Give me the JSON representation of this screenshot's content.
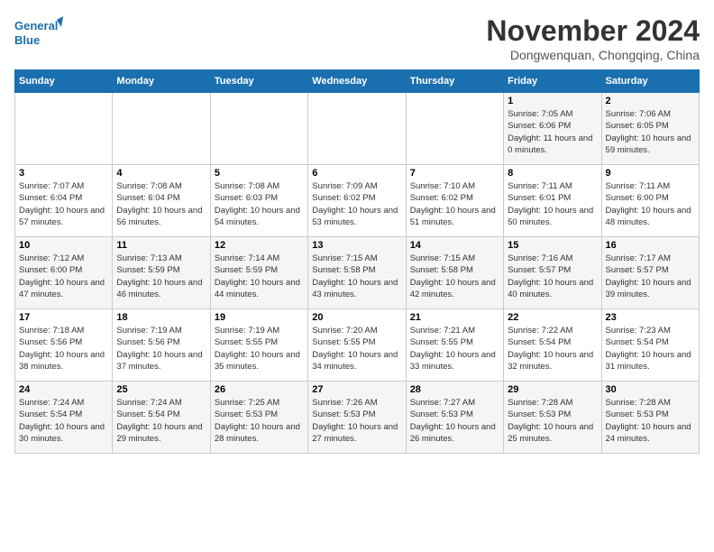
{
  "header": {
    "logo_line1": "General",
    "logo_line2": "Blue",
    "month_title": "November 2024",
    "location": "Dongwenquan, Chongqing, China"
  },
  "weekdays": [
    "Sunday",
    "Monday",
    "Tuesday",
    "Wednesday",
    "Thursday",
    "Friday",
    "Saturday"
  ],
  "weeks": [
    [
      {
        "day": "",
        "sunrise": "",
        "sunset": "",
        "daylight": ""
      },
      {
        "day": "",
        "sunrise": "",
        "sunset": "",
        "daylight": ""
      },
      {
        "day": "",
        "sunrise": "",
        "sunset": "",
        "daylight": ""
      },
      {
        "day": "",
        "sunrise": "",
        "sunset": "",
        "daylight": ""
      },
      {
        "day": "",
        "sunrise": "",
        "sunset": "",
        "daylight": ""
      },
      {
        "day": "1",
        "sunrise": "Sunrise: 7:05 AM",
        "sunset": "Sunset: 6:06 PM",
        "daylight": "Daylight: 11 hours and 0 minutes."
      },
      {
        "day": "2",
        "sunrise": "Sunrise: 7:06 AM",
        "sunset": "Sunset: 6:05 PM",
        "daylight": "Daylight: 10 hours and 59 minutes."
      }
    ],
    [
      {
        "day": "3",
        "sunrise": "Sunrise: 7:07 AM",
        "sunset": "Sunset: 6:04 PM",
        "daylight": "Daylight: 10 hours and 57 minutes."
      },
      {
        "day": "4",
        "sunrise": "Sunrise: 7:08 AM",
        "sunset": "Sunset: 6:04 PM",
        "daylight": "Daylight: 10 hours and 56 minutes."
      },
      {
        "day": "5",
        "sunrise": "Sunrise: 7:08 AM",
        "sunset": "Sunset: 6:03 PM",
        "daylight": "Daylight: 10 hours and 54 minutes."
      },
      {
        "day": "6",
        "sunrise": "Sunrise: 7:09 AM",
        "sunset": "Sunset: 6:02 PM",
        "daylight": "Daylight: 10 hours and 53 minutes."
      },
      {
        "day": "7",
        "sunrise": "Sunrise: 7:10 AM",
        "sunset": "Sunset: 6:02 PM",
        "daylight": "Daylight: 10 hours and 51 minutes."
      },
      {
        "day": "8",
        "sunrise": "Sunrise: 7:11 AM",
        "sunset": "Sunset: 6:01 PM",
        "daylight": "Daylight: 10 hours and 50 minutes."
      },
      {
        "day": "9",
        "sunrise": "Sunrise: 7:11 AM",
        "sunset": "Sunset: 6:00 PM",
        "daylight": "Daylight: 10 hours and 48 minutes."
      }
    ],
    [
      {
        "day": "10",
        "sunrise": "Sunrise: 7:12 AM",
        "sunset": "Sunset: 6:00 PM",
        "daylight": "Daylight: 10 hours and 47 minutes."
      },
      {
        "day": "11",
        "sunrise": "Sunrise: 7:13 AM",
        "sunset": "Sunset: 5:59 PM",
        "daylight": "Daylight: 10 hours and 46 minutes."
      },
      {
        "day": "12",
        "sunrise": "Sunrise: 7:14 AM",
        "sunset": "Sunset: 5:59 PM",
        "daylight": "Daylight: 10 hours and 44 minutes."
      },
      {
        "day": "13",
        "sunrise": "Sunrise: 7:15 AM",
        "sunset": "Sunset: 5:58 PM",
        "daylight": "Daylight: 10 hours and 43 minutes."
      },
      {
        "day": "14",
        "sunrise": "Sunrise: 7:15 AM",
        "sunset": "Sunset: 5:58 PM",
        "daylight": "Daylight: 10 hours and 42 minutes."
      },
      {
        "day": "15",
        "sunrise": "Sunrise: 7:16 AM",
        "sunset": "Sunset: 5:57 PM",
        "daylight": "Daylight: 10 hours and 40 minutes."
      },
      {
        "day": "16",
        "sunrise": "Sunrise: 7:17 AM",
        "sunset": "Sunset: 5:57 PM",
        "daylight": "Daylight: 10 hours and 39 minutes."
      }
    ],
    [
      {
        "day": "17",
        "sunrise": "Sunrise: 7:18 AM",
        "sunset": "Sunset: 5:56 PM",
        "daylight": "Daylight: 10 hours and 38 minutes."
      },
      {
        "day": "18",
        "sunrise": "Sunrise: 7:19 AM",
        "sunset": "Sunset: 5:56 PM",
        "daylight": "Daylight: 10 hours and 37 minutes."
      },
      {
        "day": "19",
        "sunrise": "Sunrise: 7:19 AM",
        "sunset": "Sunset: 5:55 PM",
        "daylight": "Daylight: 10 hours and 35 minutes."
      },
      {
        "day": "20",
        "sunrise": "Sunrise: 7:20 AM",
        "sunset": "Sunset: 5:55 PM",
        "daylight": "Daylight: 10 hours and 34 minutes."
      },
      {
        "day": "21",
        "sunrise": "Sunrise: 7:21 AM",
        "sunset": "Sunset: 5:55 PM",
        "daylight": "Daylight: 10 hours and 33 minutes."
      },
      {
        "day": "22",
        "sunrise": "Sunrise: 7:22 AM",
        "sunset": "Sunset: 5:54 PM",
        "daylight": "Daylight: 10 hours and 32 minutes."
      },
      {
        "day": "23",
        "sunrise": "Sunrise: 7:23 AM",
        "sunset": "Sunset: 5:54 PM",
        "daylight": "Daylight: 10 hours and 31 minutes."
      }
    ],
    [
      {
        "day": "24",
        "sunrise": "Sunrise: 7:24 AM",
        "sunset": "Sunset: 5:54 PM",
        "daylight": "Daylight: 10 hours and 30 minutes."
      },
      {
        "day": "25",
        "sunrise": "Sunrise: 7:24 AM",
        "sunset": "Sunset: 5:54 PM",
        "daylight": "Daylight: 10 hours and 29 minutes."
      },
      {
        "day": "26",
        "sunrise": "Sunrise: 7:25 AM",
        "sunset": "Sunset: 5:53 PM",
        "daylight": "Daylight: 10 hours and 28 minutes."
      },
      {
        "day": "27",
        "sunrise": "Sunrise: 7:26 AM",
        "sunset": "Sunset: 5:53 PM",
        "daylight": "Daylight: 10 hours and 27 minutes."
      },
      {
        "day": "28",
        "sunrise": "Sunrise: 7:27 AM",
        "sunset": "Sunset: 5:53 PM",
        "daylight": "Daylight: 10 hours and 26 minutes."
      },
      {
        "day": "29",
        "sunrise": "Sunrise: 7:28 AM",
        "sunset": "Sunset: 5:53 PM",
        "daylight": "Daylight: 10 hours and 25 minutes."
      },
      {
        "day": "30",
        "sunrise": "Sunrise: 7:28 AM",
        "sunset": "Sunset: 5:53 PM",
        "daylight": "Daylight: 10 hours and 24 minutes."
      }
    ]
  ]
}
